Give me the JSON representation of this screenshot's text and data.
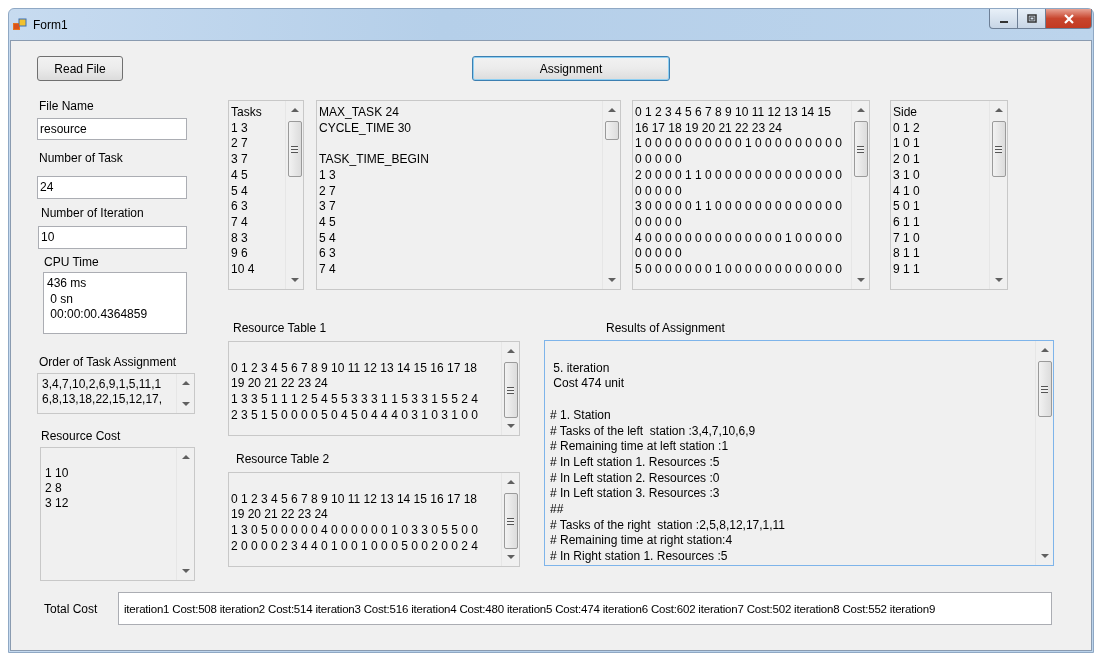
{
  "window": {
    "title": "Form1"
  },
  "buttons": {
    "read_file": "Read File",
    "assignment": "Assignment"
  },
  "inputs": [
    {
      "kind": "field",
      "label": "File Name",
      "value": "resource"
    },
    {
      "kind": "field",
      "label": "Number of Task",
      "value": "24"
    },
    {
      "kind": "field",
      "label": "Number of Iteration",
      "value": "10"
    },
    {
      "kind": "memo",
      "label": "CPU Time",
      "text": "436 ms\n 0 sn\n 00:00:00.4364859"
    },
    {
      "kind": "list",
      "label": "Order of Task Assignment",
      "text": "3,4,7,10,2,6,9,1,5,11,1\n6,8,13,18,22,15,12,17,"
    },
    {
      "kind": "list",
      "label": "Resource Cost",
      "text": "\n1 10\n2 8\n3 12"
    }
  ],
  "data_boxes": [
    {
      "text": "Tasks\n1 3\n2 7\n3 7\n4 5\n5 4\n6 3\n7 4\n8 3\n9 6\n10 4"
    },
    {
      "text": "MAX_TASK 24\nCYCLE_TIME 30\n\nTASK_TIME_BEGIN\n1 3\n2 7\n3 7\n4 5\n5 4\n6 3\n7 4"
    },
    {
      "text": "0 1 2 3 4 5 6 7 8 9 10 11 12 13 14 15\n16 17 18 19 20 21 22 23 24\n1 0 0 0 0 0 0 0 0 0 0 1 0 0 0 0 0 0 0 0 0\n0 0 0 0 0\n2 0 0 0 0 1 1 0 0 0 0 0 0 0 0 0 0 0 0 0 0\n0 0 0 0 0\n3 0 0 0 0 0 1 1 0 0 0 0 0 0 0 0 0 0 0 0 0\n0 0 0 0 0\n4 0 0 0 0 0 0 0 0 0 0 0 0 0 0 1 0 0 0 0 0\n0 0 0 0 0\n5 0 0 0 0 0 0 0 1 0 0 0 0 0 0 0 0 0 0 0 0"
    },
    {
      "text": "Side\n0 1 2\n1 0 1\n2 0 1\n3 1 0\n4 1 0\n5 0 1\n6 1 1\n7 1 0\n8 1 1\n9 1 1"
    }
  ],
  "resource_tables": [
    {
      "label": "Resource Table 1",
      "text": "\n0 1 2 3 4 5 6 7 8 9 10 11 12 13 14 15 16 17 18\n19 20 21 22 23 24\n1 3 3 5 1 1 1 2 5 4 5 5 3 3 3 1 1 5 3 3 1 5 5 2 4\n2 3 5 1 5 0 0 0 0 5 0 4 5 0 4 4 4 0 3 1 0 3 1 0 0"
    },
    {
      "label": "Resource Table 2",
      "text": "\n0 1 2 3 4 5 6 7 8 9 10 11 12 13 14 15 16 17 18\n19 20 21 22 23 24\n1 3 0 5 0 0 0 0 0 4 0 0 0 0 0 0 1 0 3 3 0 5 5 0 0\n2 0 0 0 0 2 3 4 4 0 1 0 0 1 0 0 0 5 0 0 2 0 0 2 4"
    }
  ],
  "results": {
    "label": "Results of Assignment",
    "text": "\n 5. iteration\n Cost 474 unit\n\n# 1. Station\n# Tasks of the left  station :3,4,7,10,6,9\n# Remaining time at left station :1\n# In Left station 1. Resources :5\n# In Left station 2. Resources :0\n# In Left station 3. Resources :3\n##\n# Tasks of the right  station :2,5,8,12,17,1,11\n# Remaining time at right station:4\n# In Right station 1. Resources :5"
  },
  "total_cost": {
    "label": "Total Cost",
    "value": "iteration1 Cost:508 iteration2 Cost:514 iteration3 Cost:516 iteration4 Cost:480 iteration5 Cost:474 iteration6 Cost:602 iteration7 Cost:502 iteration8 Cost:552 iteration9"
  }
}
